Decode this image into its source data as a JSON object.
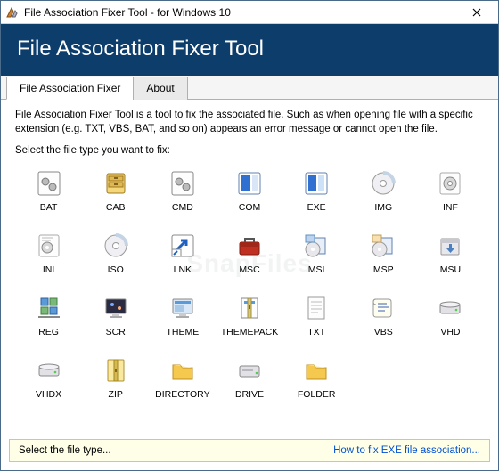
{
  "window": {
    "title": "File Association Fixer Tool - for Windows 10"
  },
  "header": {
    "title": "File Association Fixer Tool"
  },
  "tabs": [
    {
      "label": "File Association Fixer",
      "active": true
    },
    {
      "label": "About",
      "active": false
    }
  ],
  "content": {
    "description": "File Association Fixer Tool is a tool to fix the associated file. Such as when opening file with a specific extension (e.g. TXT, VBS, BAT, and so on) appears an error message or cannot open the file.",
    "prompt": "Select the file type you want to fix:"
  },
  "items": [
    {
      "label": "BAT",
      "icon": "gear-page"
    },
    {
      "label": "CAB",
      "icon": "cabinet"
    },
    {
      "label": "CMD",
      "icon": "gear-page"
    },
    {
      "label": "COM",
      "icon": "com-app"
    },
    {
      "label": "EXE",
      "icon": "exe-app"
    },
    {
      "label": "IMG",
      "icon": "disc"
    },
    {
      "label": "INF",
      "icon": "setup-gear"
    },
    {
      "label": "INI",
      "icon": "ini-gear"
    },
    {
      "label": "ISO",
      "icon": "disc"
    },
    {
      "label": "LNK",
      "icon": "shortcut"
    },
    {
      "label": "MSC",
      "icon": "toolbox"
    },
    {
      "label": "MSI",
      "icon": "installer"
    },
    {
      "label": "MSP",
      "icon": "installer-patch"
    },
    {
      "label": "MSU",
      "icon": "update-box"
    },
    {
      "label": "REG",
      "icon": "registry"
    },
    {
      "label": "SCR",
      "icon": "screensaver"
    },
    {
      "label": "THEME",
      "icon": "theme"
    },
    {
      "label": "THEMEPACK",
      "icon": "themepack"
    },
    {
      "label": "TXT",
      "icon": "text-page"
    },
    {
      "label": "VBS",
      "icon": "script"
    },
    {
      "label": "VHD",
      "icon": "disk"
    },
    {
      "label": "VHDX",
      "icon": "disk"
    },
    {
      "label": "ZIP",
      "icon": "zip"
    },
    {
      "label": "DIRECTORY",
      "icon": "folder"
    },
    {
      "label": "DRIVE",
      "icon": "drive"
    },
    {
      "label": "FOLDER",
      "icon": "folder"
    }
  ],
  "status": {
    "message": "Select the file type...",
    "link": "How to fix EXE file association..."
  },
  "icon_svg": {
    "app": "<svg width='16' height='16'><path d='M3 13 L8 3 L10 7 L7 13 Z' fill='#d08030' stroke='#805010'/><path d='M9 13 L12 6 L14 9 L12 13 Z' fill='#b0b0c0' stroke='#606070'/></svg>",
    "gear-page": "<svg width='32' height='32'><rect x='4' y='3' width='24' height='26' rx='2' fill='#fdfdfd' stroke='#888'/><circle cx='12' cy='14' r='4' fill='#bbb' stroke='#777'/><circle cx='20' cy='20' r='4' fill='#bbb' stroke='#777'/></svg>",
    "cabinet": "<svg width='32' height='32'><rect x='6' y='5' width='20' height='22' rx='2' fill='#f3d77a' stroke='#a07820'/><rect x='8' y='8' width='16' height='5' fill='#e0b850' stroke='#a07820'/><rect x='8' y='15' width='16' height='5' fill='#e0b850' stroke='#a07820'/><rect x='14' y='9' width='4' height='2' fill='#806020'/><rect x='14' y='16' width='4' height='2' fill='#806020'/></svg>",
    "com-app": "<svg width='32' height='32'><rect x='4' y='4' width='24' height='24' rx='2' fill='#fff' stroke='#6080b0'/><rect x='7' y='7' width='10' height='18' fill='#3070d0'/><rect x='19' y='7' width='6' height='18' fill='#d8e6f8'/></svg>",
    "exe-app": "<svg width='32' height='32'><rect x='4' y='4' width='24' height='24' rx='2' fill='#fff' stroke='#6080b0'/><rect x='7' y='7' width='9' height='18' fill='#3070d0'/><rect x='18' y='7' width='7' height='18' fill='#cde2f8'/></svg>",
    "disc": "<svg width='32' height='32'><circle cx='16' cy='16' r='12' fill='#f0f0f4' stroke='#999'/><circle cx='16' cy='16' r='3.5' fill='#fff' stroke='#999'/><path d='M16 4 A12 12 0 0 1 28 16' fill='none' stroke='#c4d4e4' stroke-width='4'/></svg>",
    "setup-gear": "<svg width='32' height='32'><rect x='5' y='4' width='22' height='24' rx='2' fill='#fdfdfd' stroke='#aaa'/><circle cx='16' cy='16' r='7' fill='#d8d8d8' stroke='#888'/><circle cx='16' cy='16' r='2.5' fill='#fff' stroke='#888'/></svg>",
    "ini-gear": "<svg width='32' height='32'><rect x='5' y='4' width='22' height='24' rx='2' fill='#fdfdfd' stroke='#aaa'/><circle cx='14' cy='18' r='6' fill='#d8d8d8' stroke='#888'/><circle cx='14' cy='18' r='2' fill='#fff'/><path d='M8 7 h12 M8 10 h10' stroke='#bbb'/></svg>",
    "shortcut": "<svg width='32' height='32'><rect x='4' y='4' width='24' height='24' rx='2' fill='#fff' stroke='#888'/><path d='M10 20 L20 10 M14 10 h6 v6' fill='none' stroke='#2060c0' stroke-width='3'/><rect x='4' y='20' width='10' height='8' fill='#fff' stroke='#888'/><path d='M6 26 l4 -4' stroke='#2060c0' stroke-width='2'/></svg>",
    "toolbox": "<svg width='32' height='32'><rect x='5' y='12' width='22' height='14' rx='2' fill='#c03020' stroke='#801810'/><rect x='5' y='12' width='22' height='5' fill='#a02818'/><path d='M11 12 v-4 h10 v4' fill='none' stroke='#555' stroke-width='2'/></svg>",
    "installer": "<svg width='32' height='32'><rect x='12' y='7' width='14' height='18' fill='#e8eff8' stroke='#6080b0'/><circle cx='12' cy='20' r='8' fill='#e8e8ec' stroke='#999'/><circle cx='12' cy='20' r='2' fill='#fff'/><rect x='4' y='4' width='10' height='8' fill='#bcd4f0' stroke='#6090c0'/></svg>",
    "installer-patch": "<svg width='32' height='32'><rect x='12' y='7' width='14' height='18' fill='#e8eff8' stroke='#6080b0'/><circle cx='12' cy='20' r='8' fill='#e8e8ec' stroke='#999'/><circle cx='12' cy='20' r='2' fill='#fff'/><rect x='4' y='4' width='10' height='8' fill='#f8e0b0' stroke='#c0a060'/></svg>",
    "update-box": "<svg width='32' height='32'><rect x='6' y='8' width='20' height='18' rx='1' fill='#e8e8ec' stroke='#999'/><rect x='6' y='8' width='20' height='5' fill='#c8c8d0'/><path d='M15 14 h3 v5 h3 l-4.5 5 -4.5 -5 h3 z' fill='#4a80c0'/></svg>",
    "registry": "<svg width='32' height='32'><rect x='7' y='5' width='8' height='8' fill='#5a9ad8' stroke='#3060a0'/><rect x='17' y='5' width='8' height='8' fill='#7ab87a' stroke='#408040'/><rect x='7' y='15' width='8' height='8' fill='#7ab87a' stroke='#408040'/><rect x='17' y='15' width='8' height='8' fill='#5a9ad8' stroke='#3060a0'/><path d='M4 26 h24' stroke='#888' stroke-width='2'/></svg>",
    "screensaver": "<svg width='32' height='32'><rect x='5' y='6' width='22' height='16' rx='1' fill='#2a2a40' stroke='#888'/><circle cx='12' cy='12' r='2' fill='#7af'/><circle cx='20' cy='16' r='2' fill='#fa7'/><rect x='12' y='22' width='8' height='3' fill='#ccc'/><rect x='9' y='25' width='14' height='2' fill='#aaa'/></svg>",
    "theme": "<svg width='32' height='32'><rect x='5' y='6' width='22' height='16' rx='1' fill='#d8e8f8' stroke='#888'/><rect x='7' y='8' width='18' height='3' fill='#5a9ad8'/><rect x='7' y='13' width='10' height='7' fill='#a8c8e8'/><rect x='12' y='22' width='8' height='3' fill='#ccc'/><rect x='9' y='25' width='14' height='2' fill='#aaa'/></svg>",
    "themepack": "<svg width='32' height='32'><rect x='7' y='5' width='18' height='22' fill='#fdfdfd' stroke='#888'/><rect x='10' y='8' width='12' height='3' fill='#5a9ad8'/><rect x='14' y='5' width='4' height='22' fill='#d8c878' stroke='#a09040'/><rect x='15' y='13' width='2' height='4' fill='#806820'/></svg>",
    "text-page": "<svg width='32' height='32'><rect x='7' y='4' width='18' height='24' fill='#fdfdfd' stroke='#999'/><path d='M10 9 h12 M10 13 h12 M10 17 h12 M10 21 h8' stroke='#bbb'/></svg>",
    "script": "<svg width='32' height='32'><path d='M8 6 q-3 0 -3 3 v14 q0 3 3 3 h14 q3 0 3 -3 V9 q0 -3 -3 -3 z' fill='#fdfdf0' stroke='#999'/><path d='M10 11 h10 M10 15 h12 M10 19 h8' stroke='#4060b0'/><path d='M8 6 q-3 0 -3 3 q0 3 3 3' fill='none' stroke='#999'/></svg>",
    "disk": "<svg width='32' height='32'><rect x='5' y='12' width='22' height='10' rx='2' fill='#e2e2e6' stroke='#888'/><ellipse cx='16' cy='12' rx='11' ry='3' fill='#f2f2f6' stroke='#888'/><circle cx='23' cy='18' r='1.3' fill='#5c5'/></svg>",
    "zip": "<svg width='32' height='32'><rect x='7' y='4' width='18' height='24' rx='1' fill='#f8e8a0' stroke='#b09030'/><rect x='14' y='4' width='4' height='24' fill='#d8b850' stroke='#a08820'/><rect x='15' y='14' width='2' height='4' fill='#806820'/></svg>",
    "folder": "<svg width='32' height='32'><path d='M5 10 h8 l3 3 h11 v13 H5 z' fill='#f5c94e' stroke='#c09020'/><path d='M5 10 h8 l3 3 h11' fill='#f8dd80'/></svg>",
    "drive": "<svg width='32' height='32'><rect x='5' y='11' width='22' height='12' rx='2' fill='#e2e2e6' stroke='#888'/><rect x='8' y='14' width='12' height='3' fill='#b8b8c0'/><circle cx='24' cy='19' r='1.3' fill='#5c5'/></svg>"
  }
}
